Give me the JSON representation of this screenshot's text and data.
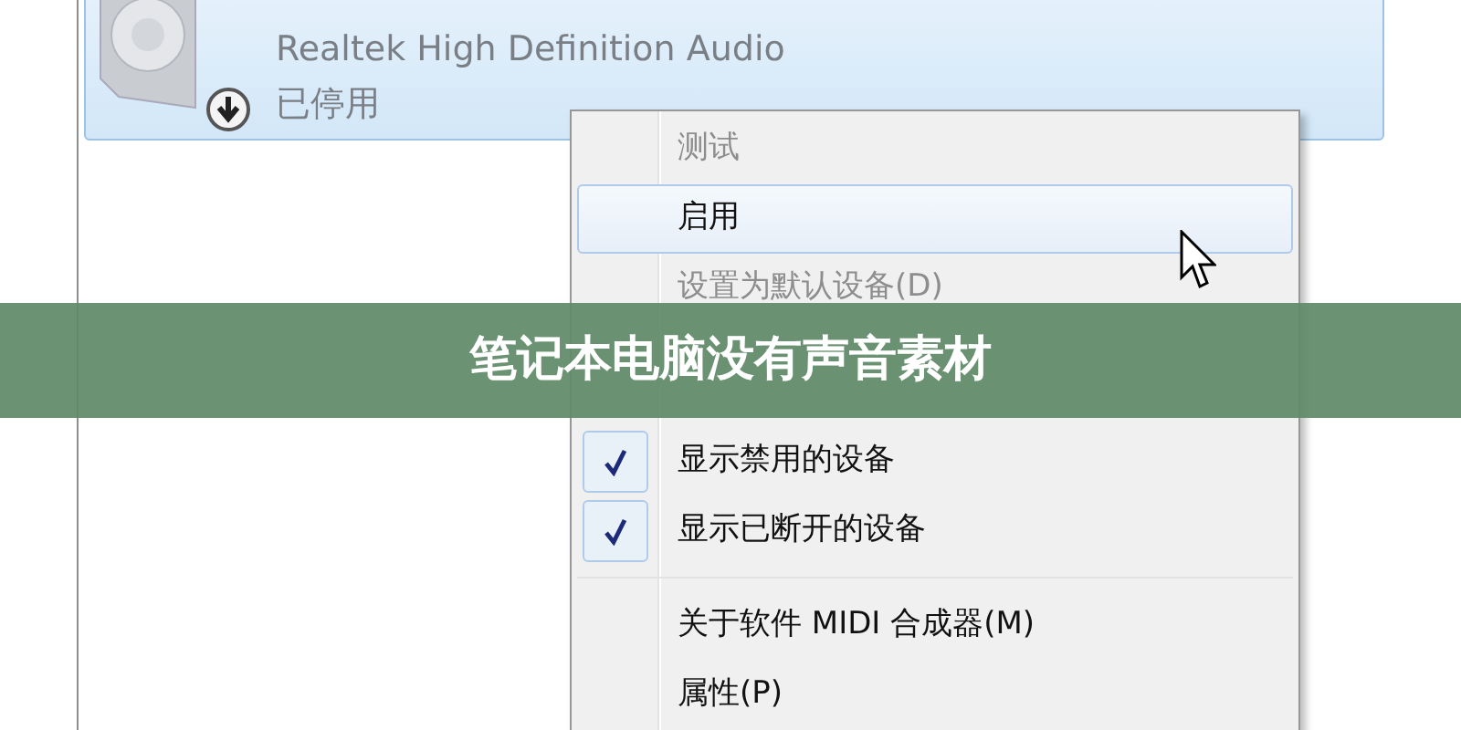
{
  "device": {
    "driver": "Realtek High Definition Audio",
    "status": "已停用",
    "selected": true
  },
  "context_menu": {
    "groups": [
      {
        "items": [
          {
            "label": "测试",
            "disabled": true,
            "selected": false,
            "checked": false
          },
          {
            "label": "启用",
            "disabled": false,
            "selected": true,
            "checked": false
          },
          {
            "label": "设置为默认设备(D)",
            "disabled": true,
            "selected": false,
            "checked": false
          }
        ]
      },
      {
        "items": [
          {
            "label": "显示禁用的设备",
            "disabled": false,
            "selected": false,
            "checked": true
          },
          {
            "label": "显示已断开的设备",
            "disabled": false,
            "selected": false,
            "checked": true
          }
        ]
      },
      {
        "items": [
          {
            "label": "关于软件 MIDI 合成器(M)",
            "disabled": false,
            "selected": false,
            "checked": false
          },
          {
            "label": "属性(P)",
            "disabled": false,
            "selected": false,
            "checked": false
          }
        ]
      }
    ]
  },
  "banner": {
    "title": "笔记本电脑没有声音素材"
  }
}
